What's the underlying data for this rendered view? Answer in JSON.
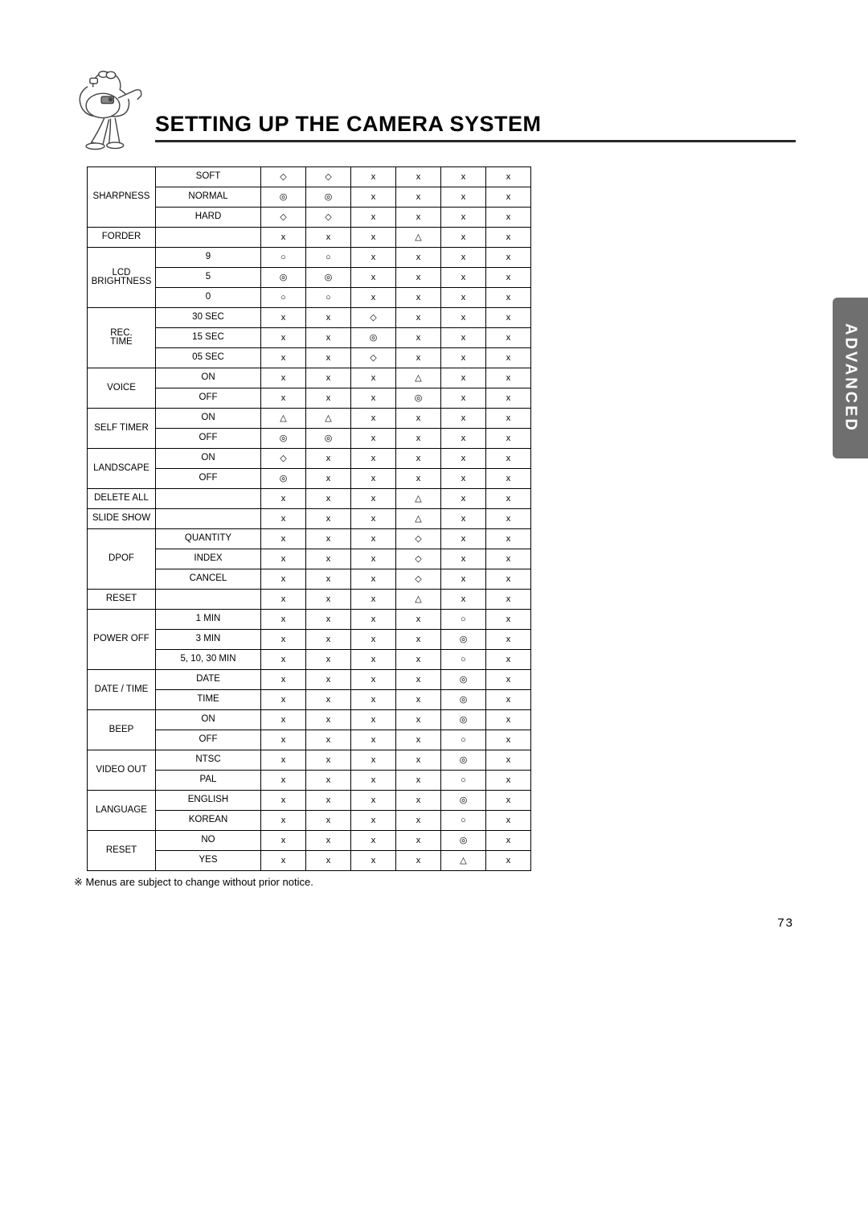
{
  "header": {
    "title": "SETTING UP THE CAMERA SYSTEM"
  },
  "sideTab": "ADVANCED",
  "footnote": "Menus are subject to change without prior notice.",
  "pageNumber": "73",
  "noteMark": "※",
  "table": {
    "rows": [
      {
        "cat": "SHARPNESS",
        "rowspan": 3,
        "sub": "SOFT",
        "cells": [
          "◇",
          "◇",
          "x",
          "x",
          "x",
          "x"
        ]
      },
      {
        "sub": "NORMAL",
        "cells": [
          "◎",
          "◎",
          "x",
          "x",
          "x",
          "x"
        ]
      },
      {
        "sub": "HARD",
        "cells": [
          "◇",
          "◇",
          "x",
          "x",
          "x",
          "x"
        ]
      },
      {
        "cat": "FORDER",
        "rowspan": 1,
        "sub": "",
        "cells": [
          "x",
          "x",
          "x",
          "△",
          "x",
          "x"
        ]
      },
      {
        "cat": "LCD BRIGHTNESS",
        "rowspan": 3,
        "sub": "9",
        "cells": [
          "○",
          "○",
          "x",
          "x",
          "x",
          "x"
        ]
      },
      {
        "sub": "5",
        "cells": [
          "◎",
          "◎",
          "x",
          "x",
          "x",
          "x"
        ]
      },
      {
        "sub": "0",
        "cells": [
          "○",
          "○",
          "x",
          "x",
          "x",
          "x"
        ]
      },
      {
        "cat": "REC. TIME",
        "rowspan": 3,
        "sub": "30 SEC",
        "cells": [
          "x",
          "x",
          "◇",
          "x",
          "x",
          "x"
        ]
      },
      {
        "sub": "15 SEC",
        "cells": [
          "x",
          "x",
          "◎",
          "x",
          "x",
          "x"
        ]
      },
      {
        "sub": "05 SEC",
        "cells": [
          "x",
          "x",
          "◇",
          "x",
          "x",
          "x"
        ]
      },
      {
        "cat": "VOICE",
        "rowspan": 2,
        "sub": "ON",
        "cells": [
          "x",
          "x",
          "x",
          "△",
          "x",
          "x"
        ]
      },
      {
        "sub": "OFF",
        "cells": [
          "x",
          "x",
          "x",
          "◎",
          "x",
          "x"
        ]
      },
      {
        "cat": "SELF TIMER",
        "rowspan": 2,
        "sub": "ON",
        "cells": [
          "△",
          "△",
          "x",
          "x",
          "x",
          "x"
        ]
      },
      {
        "sub": "OFF",
        "cells": [
          "◎",
          "◎",
          "x",
          "x",
          "x",
          "x"
        ]
      },
      {
        "cat": "LANDSCAPE",
        "rowspan": 2,
        "sub": "ON",
        "cells": [
          "◇",
          "x",
          "x",
          "x",
          "x",
          "x"
        ]
      },
      {
        "sub": "OFF",
        "cells": [
          "◎",
          "x",
          "x",
          "x",
          "x",
          "x"
        ]
      },
      {
        "cat": "DELETE ALL",
        "rowspan": 1,
        "sub": "",
        "cells": [
          "x",
          "x",
          "x",
          "△",
          "x",
          "x"
        ]
      },
      {
        "cat": "SLIDE SHOW",
        "rowspan": 1,
        "sub": "",
        "cells": [
          "x",
          "x",
          "x",
          "△",
          "x",
          "x"
        ]
      },
      {
        "cat": "DPOF",
        "rowspan": 3,
        "sub": "QUANTITY",
        "cells": [
          "x",
          "x",
          "x",
          "◇",
          "x",
          "x"
        ]
      },
      {
        "sub": "INDEX",
        "cells": [
          "x",
          "x",
          "x",
          "◇",
          "x",
          "x"
        ]
      },
      {
        "sub": "CANCEL",
        "cells": [
          "x",
          "x",
          "x",
          "◇",
          "x",
          "x"
        ]
      },
      {
        "cat": "RESET",
        "rowspan": 1,
        "sub": "",
        "cells": [
          "x",
          "x",
          "x",
          "△",
          "x",
          "x"
        ]
      },
      {
        "cat": "POWER OFF",
        "rowspan": 3,
        "sub": "1 MIN",
        "cells": [
          "x",
          "x",
          "x",
          "x",
          "○",
          "x"
        ]
      },
      {
        "sub": "3 MIN",
        "cells": [
          "x",
          "x",
          "x",
          "x",
          "◎",
          "x"
        ]
      },
      {
        "sub": "5, 10, 30 MIN",
        "cells": [
          "x",
          "x",
          "x",
          "x",
          "○",
          "x"
        ]
      },
      {
        "cat": "DATE / TIME",
        "rowspan": 2,
        "sub": "DATE",
        "cells": [
          "x",
          "x",
          "x",
          "x",
          "◎",
          "x"
        ]
      },
      {
        "sub": "TIME",
        "cells": [
          "x",
          "x",
          "x",
          "x",
          "◎",
          "x"
        ]
      },
      {
        "cat": "BEEP",
        "rowspan": 2,
        "sub": "ON",
        "cells": [
          "x",
          "x",
          "x",
          "x",
          "◎",
          "x"
        ]
      },
      {
        "sub": "OFF",
        "cells": [
          "x",
          "x",
          "x",
          "x",
          "○",
          "x"
        ]
      },
      {
        "cat": "VIDEO OUT",
        "rowspan": 2,
        "sub": "NTSC",
        "cells": [
          "x",
          "x",
          "x",
          "x",
          "◎",
          "x"
        ]
      },
      {
        "sub": "PAL",
        "cells": [
          "x",
          "x",
          "x",
          "x",
          "○",
          "x"
        ]
      },
      {
        "cat": "LANGUAGE",
        "rowspan": 2,
        "sub": "ENGLISH",
        "cells": [
          "x",
          "x",
          "x",
          "x",
          "◎",
          "x"
        ]
      },
      {
        "sub": "KOREAN",
        "cells": [
          "x",
          "x",
          "x",
          "x",
          "○",
          "x"
        ]
      },
      {
        "cat": "RESET",
        "rowspan": 2,
        "sub": "NO",
        "cells": [
          "x",
          "x",
          "x",
          "x",
          "◎",
          "x"
        ]
      },
      {
        "sub": "YES",
        "cells": [
          "x",
          "x",
          "x",
          "x",
          "△",
          "x"
        ]
      }
    ]
  }
}
